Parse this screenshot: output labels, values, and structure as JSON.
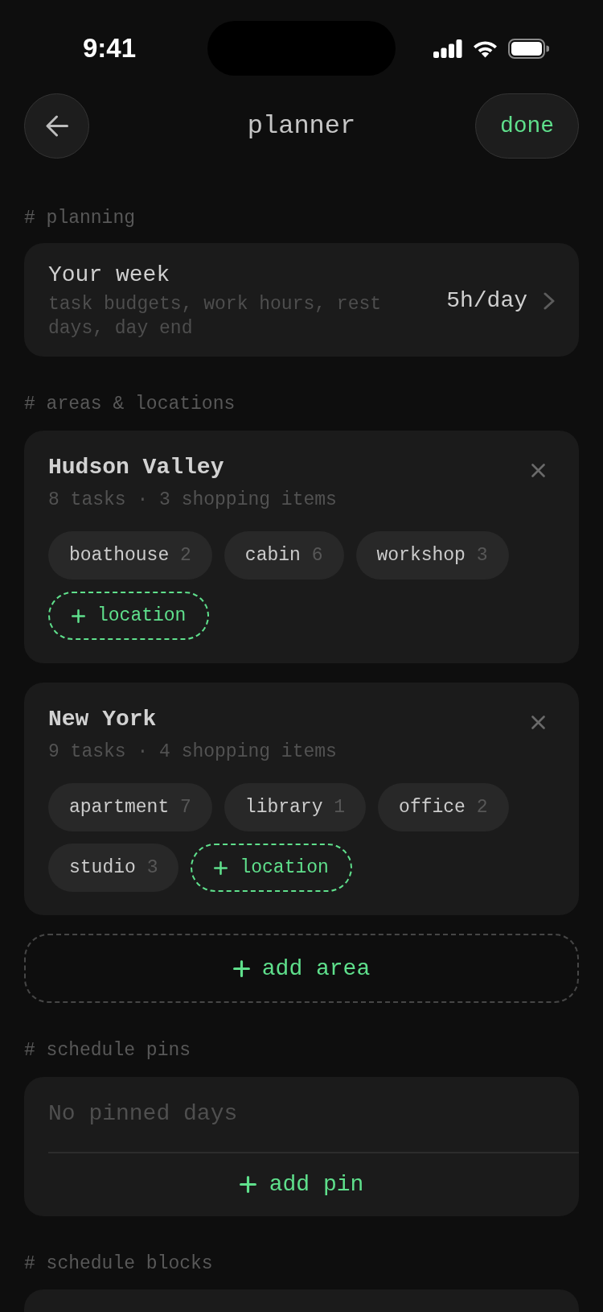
{
  "status_bar": {
    "time": "9:41"
  },
  "header": {
    "title": "planner",
    "done_label": "done"
  },
  "planning": {
    "heading": "# planning",
    "row": {
      "title": "Your week",
      "subtitle": "task budgets, work hours, rest days, day end",
      "value": "5h/day"
    }
  },
  "areas_section": {
    "heading": "# areas & locations",
    "areas": [
      {
        "name": "Hudson Valley",
        "summary": "8 tasks · 3 shopping items",
        "locations": [
          {
            "name": "boathouse",
            "count": "2"
          },
          {
            "name": "cabin",
            "count": "6"
          },
          {
            "name": "workshop",
            "count": "3"
          }
        ],
        "add_location_label": "location"
      },
      {
        "name": "New York",
        "summary": "9 tasks · 4 shopping items",
        "locations": [
          {
            "name": "apartment",
            "count": "7"
          },
          {
            "name": "library",
            "count": "1"
          },
          {
            "name": "office",
            "count": "2"
          },
          {
            "name": "studio",
            "count": "3"
          }
        ],
        "add_location_label": "location"
      }
    ],
    "add_area_label": "add area"
  },
  "schedule_pins": {
    "heading": "# schedule pins",
    "empty_text": "No pinned days",
    "add_pin_label": "add pin"
  },
  "schedule_blocks": {
    "heading": "# schedule blocks"
  }
}
